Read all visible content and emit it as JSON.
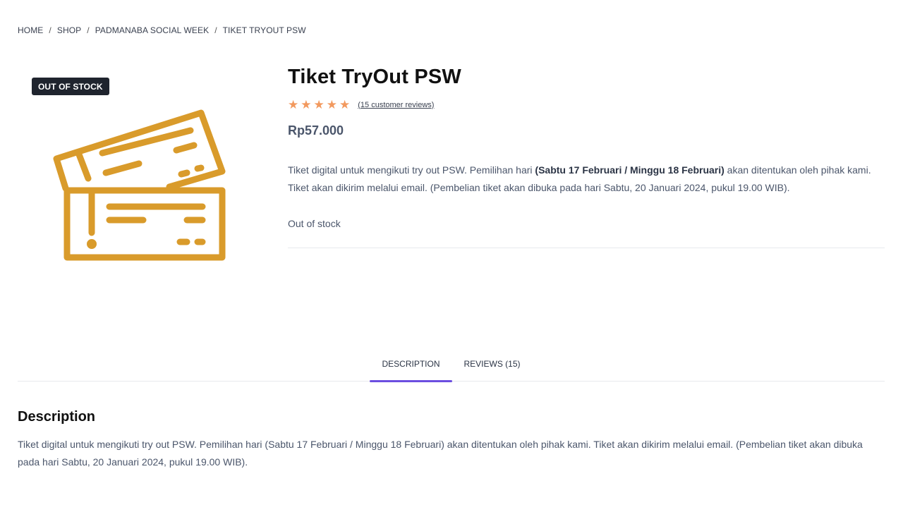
{
  "breadcrumb": [
    "HOME",
    "SHOP",
    "PADMANABA SOCIAL WEEK",
    "TIKET TRYOUT PSW"
  ],
  "gallery": {
    "badge": "OUT OF STOCK",
    "image_icon": "ticket-icon",
    "icon_color": "#d99b2b"
  },
  "product": {
    "title": "Tiket TryOut PSW",
    "rating": 5,
    "reviews_text": "(15 customer reviews)",
    "price": "Rp57.000",
    "desc_part1": "Tiket digital untuk mengikuti try out PSW. Pemilihan hari ",
    "desc_bold": "(Sabtu 17 Februari / Minggu 18 Februari)",
    "desc_part2": " akan ditentukan oleh pihak kami. Tiket akan dikirim melalui email. (Pembelian tiket akan dibuka pada hari Sabtu, 20 Januari 2024, pukul 19.00 WIB).",
    "stock": "Out of stock"
  },
  "tabs": [
    {
      "label": "DESCRIPTION",
      "active": true
    },
    {
      "label": "REVIEWS (15)",
      "active": false
    }
  ],
  "description_panel": {
    "title": "Description",
    "text": "Tiket digital untuk mengikuti try out PSW. Pemilihan hari (Sabtu 17 Februari / Minggu 18 Februari) akan ditentukan oleh pihak kami. Tiket akan dikirim melalui email. (Pembelian tiket akan dibuka pada hari Sabtu, 20 Januari 2024, pukul 19.00 WIB)."
  },
  "colors": {
    "accent": "#6b4ee0",
    "star": "#f2995e",
    "badge_bg": "#1f242e"
  }
}
